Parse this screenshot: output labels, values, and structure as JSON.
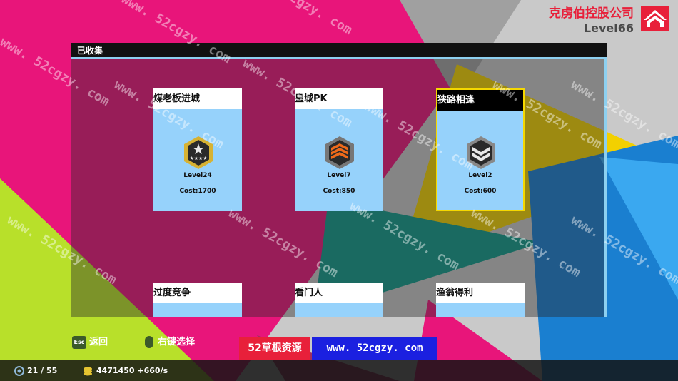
{
  "company": {
    "name": "克虏伯控股公司",
    "level": "Level66"
  },
  "panel": {
    "title": "已收集"
  },
  "cards": [
    {
      "title": "煤老板进城",
      "level": "Level24",
      "cost": "Cost:1700",
      "selected": false
    },
    {
      "title": "皇城PK",
      "level": "Level7",
      "cost": "Cost:850",
      "selected": false
    },
    {
      "title": "狭路相逢",
      "level": "Level2",
      "cost": "Cost:600",
      "selected": true
    },
    {
      "title": "过度竞争"
    },
    {
      "title": "看门人"
    },
    {
      "title": "渔翁得利"
    }
  ],
  "hints": {
    "esc_key": "Esc",
    "back": "返回",
    "right_click": "右键选择"
  },
  "promo": {
    "site_name": "52草根资源",
    "url": "www. 52cgzy. com"
  },
  "status": {
    "progress": "21 / 55",
    "money": "4471450 +660/s"
  },
  "watermark": "www. 52cgzy. com"
}
